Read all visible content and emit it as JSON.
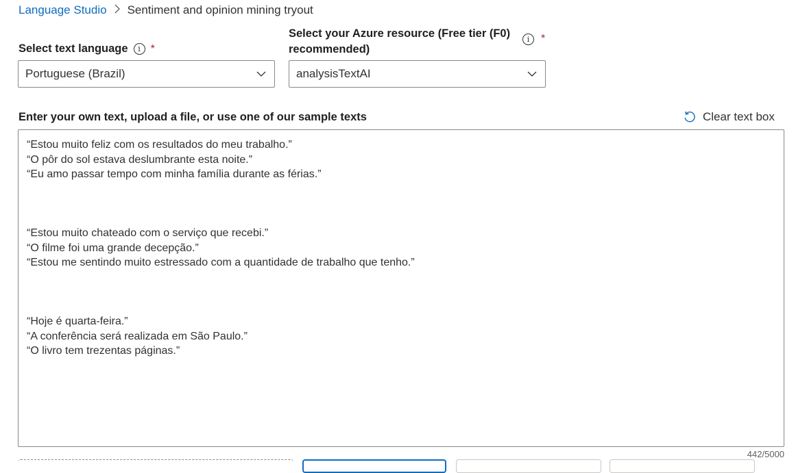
{
  "breadcrumb": {
    "parent": "Language Studio",
    "separator": ">",
    "current": "Sentiment and opinion mining tryout"
  },
  "language_field": {
    "label": "Select text language",
    "required_marker": "*",
    "value": "Portuguese (Brazil)"
  },
  "resource_field": {
    "label_line1": "Select your Azure resource (Free tier (F0)",
    "label_line2": "recommended)",
    "required_marker": "*",
    "value": "analysisTextAI"
  },
  "text_section": {
    "label": "Enter your own text, upload a file, or use one of our sample texts",
    "clear_label": "Clear text box",
    "text": "“Estou muito feliz com os resultados do meu trabalho.”\n“O pôr do sol estava deslumbrante esta noite.”\n“Eu amo passar tempo com minha família durante as férias.”\n\n\n\n“Estou muito chateado com o serviço que recebi.”\n“O filme foi uma grande decepção.”\n“Estou me sentindo muito estressado com a quantidade de trabalho que tenho.”\n\n\n\n“Hoje é quarta-feira.”\n“A conferência será realizada em São Paulo.”\n“O livro tem trezentas páginas.”",
    "char_count": "442/5000"
  },
  "colors": {
    "link": "#0f6cbd",
    "required": "#a4262c",
    "border": "#8a8886"
  },
  "icons": {
    "info": "info-icon",
    "chevron": "chevron-down-icon",
    "clear": "undo-icon"
  }
}
